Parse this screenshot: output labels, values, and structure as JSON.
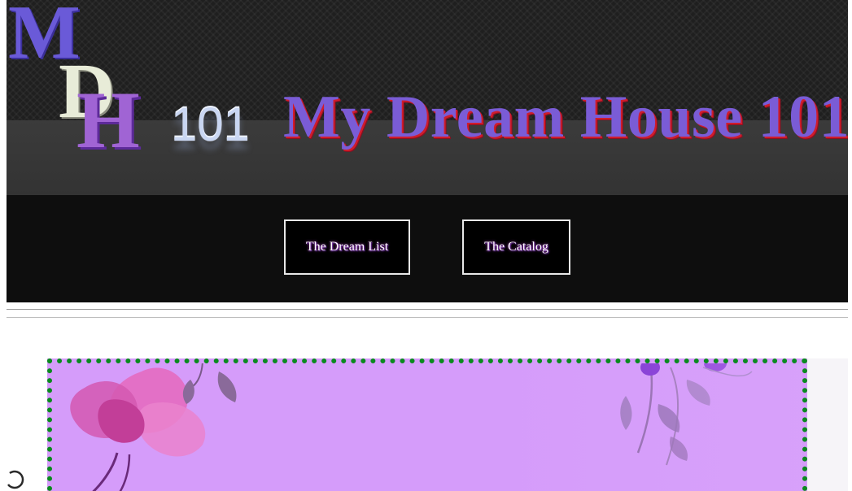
{
  "header": {
    "logo": {
      "letter_m": "M",
      "letter_d": "D",
      "letter_h": "H",
      "number": "101"
    },
    "title": "My Dream House 101"
  },
  "nav": {
    "items": [
      {
        "label": "The Dream List"
      },
      {
        "label": "The Catalog"
      }
    ]
  },
  "colors": {
    "title": "#7a5cd6",
    "title_shadow": "#d01c2c",
    "nav_background": "#0e0e0e",
    "banner": "#d59cfa",
    "banner_border": "#0a8a1e"
  },
  "icons": {
    "loader": "spinner-icon"
  }
}
